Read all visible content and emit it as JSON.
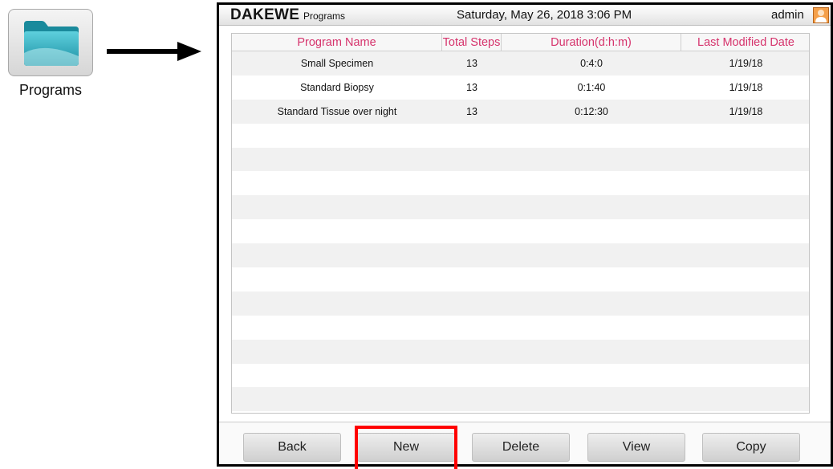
{
  "launcher": {
    "label": "Programs",
    "icon": "folder-icon"
  },
  "header": {
    "brand": "DAKEWE",
    "section": "Programs",
    "datetime": "Saturday, May 26, 2018  3:06 PM",
    "user": "admin",
    "user_icon": "user-avatar-icon"
  },
  "table": {
    "columns": [
      "Program Name",
      "Total Steps",
      "Duration(d:h:m)",
      "Last Modified Date"
    ],
    "rows": [
      [
        "Small Specimen",
        "13",
        "0:4:0",
        "1/19/18"
      ],
      [
        "Standard Biopsy",
        "13",
        "0:1:40",
        "1/19/18"
      ],
      [
        "Standard Tissue over night",
        "13",
        "0:12:30",
        "1/19/18"
      ]
    ],
    "header_color": "#d6336c",
    "stripe_color": "#f1f1f1"
  },
  "buttons": {
    "back": "Back",
    "new": "New",
    "delete": "Delete",
    "view": "View",
    "copy": "Copy"
  },
  "annotation": {
    "highlight_color": "#ff0000",
    "arrow_color": "#000000"
  }
}
